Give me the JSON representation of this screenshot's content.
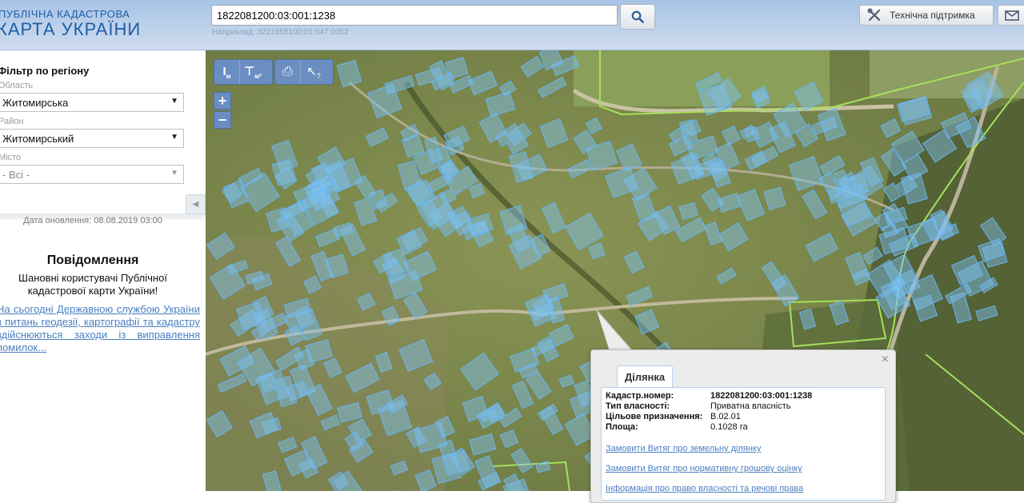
{
  "header": {
    "logo_line1": "ПУБЛІЧНА КАДАСТРОВА",
    "logo_line2": "КАРТА УКРАЇНИ",
    "search_value": "1822081200:03:001:1238",
    "search_hint": "Наприклад: 3221655100:01:047:0052",
    "support_label": "Технічна підтримка",
    "icons": {
      "search": "search-icon",
      "support": "tools-icon",
      "mail": "mail-icon"
    }
  },
  "sidebar": {
    "filter_title": "Фільтр по регіону",
    "oblast_label": "Область",
    "oblast_value": "Житомирська",
    "rayon_label": "Район",
    "rayon_value": "Житомирський",
    "misto_label": "Місто",
    "misto_value": "- Всі -",
    "update_date": "Дата оновлення: 08.08.2019 03:00",
    "message_title": "Повідомлення",
    "message_text": "Шановні користувачі Публічної кадастрової карти України!",
    "message_link": "На сьогодні Державною службою України з питань геодезії, картографії та кадастру здійснюються заходи із виправлення помилок..."
  },
  "map": {
    "tools": [
      {
        "name": "measure-distance",
        "glyph": "I",
        "sub": "м"
      },
      {
        "name": "measure-area",
        "glyph": "⊤",
        "sub": "м²"
      },
      {
        "name": "print",
        "glyph": "⎙",
        "sub": ""
      },
      {
        "name": "identify",
        "glyph": "↖",
        "sub": "?"
      }
    ],
    "zoom_in": "+",
    "zoom_out": "−",
    "colors": {
      "parcel_fill": "#7fc3f5",
      "parcel_stroke": "#67b4ef",
      "boundary": "#a6e05a",
      "imagery": "#7d8a4c"
    }
  },
  "popup": {
    "tab_label": "Ділянка",
    "close_label": "×",
    "rows": [
      {
        "key": "Кадастр.номер:",
        "value": "1822081200:03:001:1238",
        "bold": true
      },
      {
        "key": "Тип власності:",
        "value": "Приватна власність",
        "bold": false
      },
      {
        "key": "Цільове призначення:",
        "value": "В.02.01",
        "bold": false
      },
      {
        "key": "Площа:",
        "value": "0.1028 га",
        "bold": false
      }
    ],
    "links": [
      "Замовити Витяг про земельну ділянку",
      "Замовити Витяг про нормативну грошову оцінку",
      "Інформація про право власності та речові права"
    ]
  }
}
